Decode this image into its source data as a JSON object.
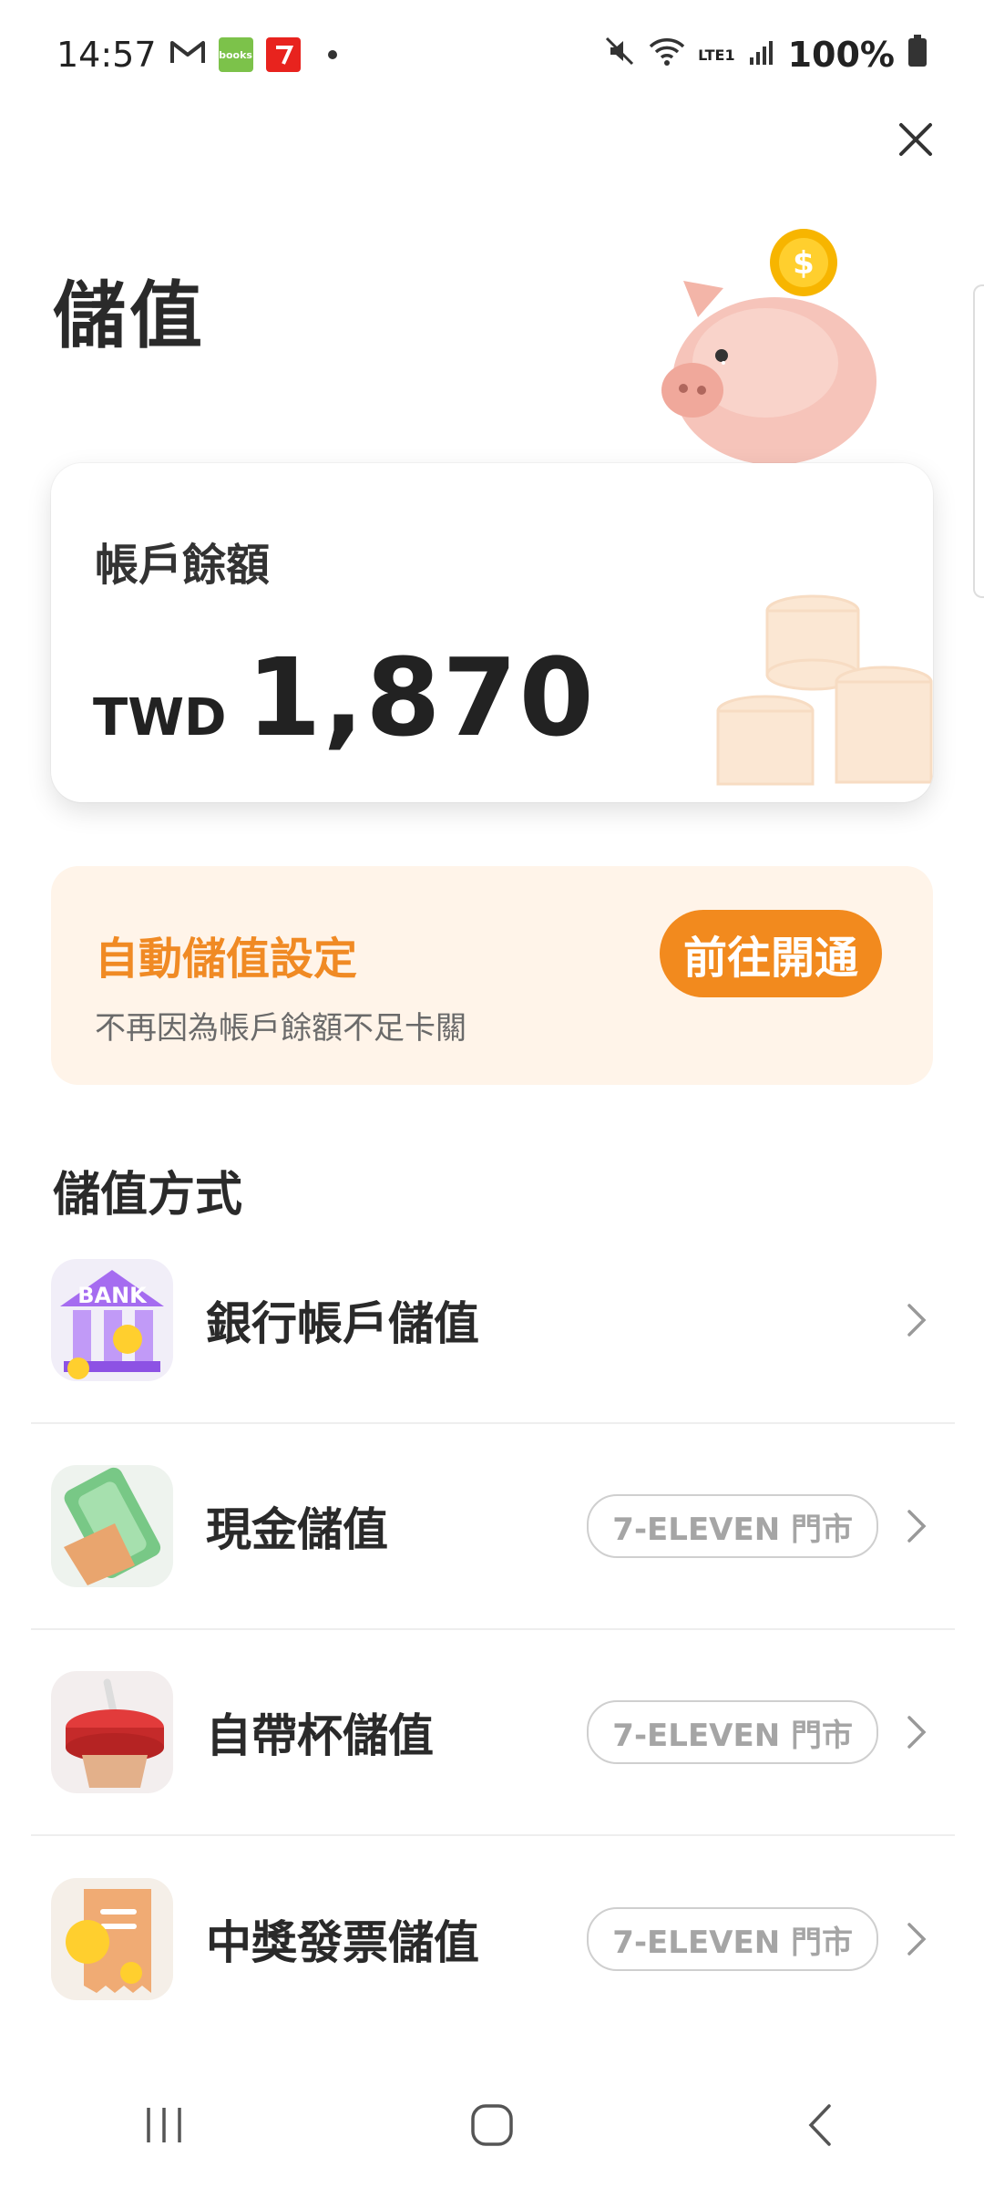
{
  "status": {
    "time": "14:57",
    "app_books_label": "books",
    "battery": "100%",
    "network": "LTE1"
  },
  "page": {
    "title": "儲值"
  },
  "balance": {
    "label": "帳戶餘額",
    "currency": "TWD",
    "amount": "1,870"
  },
  "auto_topup": {
    "title": "自動儲值設定",
    "subtitle": "不再因為帳戶餘額不足卡關",
    "button": "前往開通"
  },
  "methods_section": {
    "title": "儲值方式",
    "items": [
      {
        "label": "銀行帳戶儲值",
        "tag": "",
        "icon": "bank-icon"
      },
      {
        "label": "現金儲值",
        "tag": "7-ELEVEN 門市",
        "icon": "cash-icon"
      },
      {
        "label": "自帶杯儲值",
        "tag": "7-ELEVEN 門市",
        "icon": "cup-icon"
      },
      {
        "label": "中獎發票儲值",
        "tag": "7-ELEVEN 門市",
        "icon": "invoice-icon"
      }
    ]
  },
  "bank_icon_text": "BANK",
  "colors": {
    "accent": "#f28a1e",
    "accent_bg": "#fff4e9"
  }
}
